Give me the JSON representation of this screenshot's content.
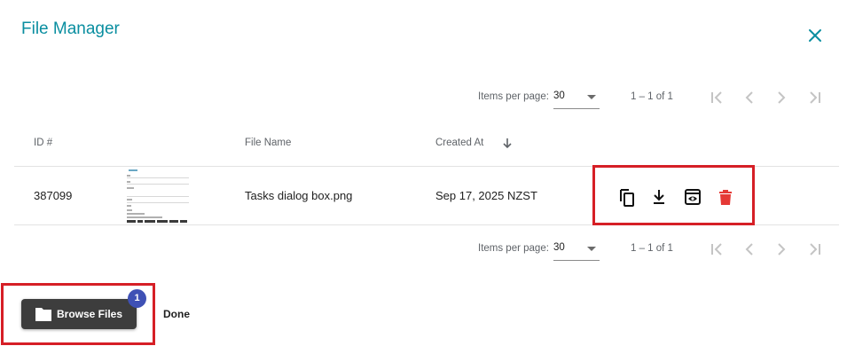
{
  "dialog": {
    "title": "File Manager"
  },
  "paginator": {
    "items_per_page_label": "Items per page:",
    "items_per_page_value": "30",
    "range_label": "1 – 1 of 1"
  },
  "table": {
    "columns": {
      "id": "ID #",
      "thumbnail": "",
      "file_name": "File Name",
      "created_at": "Created At"
    },
    "rows": [
      {
        "id": "387099",
        "file_name": "Tasks dialog box.png",
        "created_at": "Sep 17, 2025 NZST"
      }
    ]
  },
  "actions": {
    "browse_files_label": "Browse Files",
    "browse_badge_count": "1",
    "done_label": "Done"
  },
  "colors": {
    "title": "#0a8ea0",
    "delete_icon": "#e53935",
    "highlight_border": "#d61f26",
    "badge": "#3f51b5",
    "browse_button": "#3d3d3d"
  },
  "icons": {
    "close": "close-icon",
    "first_page": "first-page-icon",
    "prev_page": "chevron-left-icon",
    "next_page": "chevron-right-icon",
    "last_page": "last-page-icon",
    "sort": "arrow-down-icon",
    "copy": "copy-icon",
    "download": "download-icon",
    "preview": "preview-icon",
    "delete": "trash-icon",
    "folder": "folder-icon"
  }
}
